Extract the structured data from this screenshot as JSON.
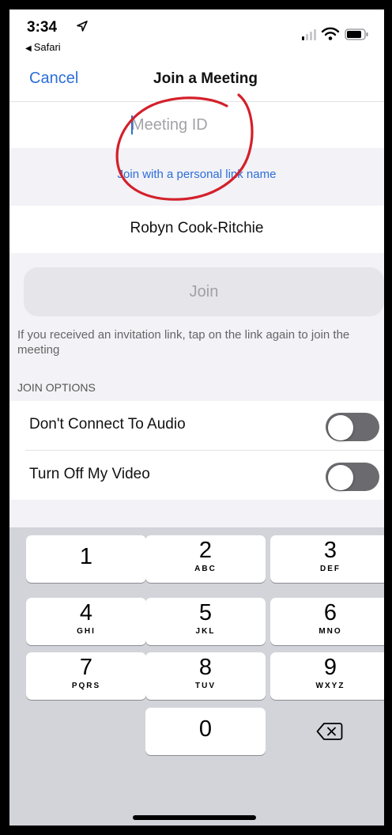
{
  "status_bar": {
    "time": "3:34",
    "back_app": "Safari"
  },
  "nav": {
    "cancel_label": "Cancel",
    "title": "Join a Meeting"
  },
  "meeting_id": {
    "placeholder": "Meeting ID",
    "value": ""
  },
  "personal_link_label": "Join with a personal link name",
  "display_name": "Robyn Cook-Ritchie",
  "join_label": "Join",
  "invite_hint": "If you received an invitation link, tap on the link again to join the meeting",
  "join_options": {
    "title": "JOIN OPTIONS",
    "options": [
      {
        "label": "Don't Connect To Audio",
        "enabled": false
      },
      {
        "label": "Turn Off My Video",
        "enabled": false
      }
    ]
  },
  "keypad": {
    "keys": [
      {
        "number": "1",
        "letters": ""
      },
      {
        "number": "2",
        "letters": "ABC"
      },
      {
        "number": "3",
        "letters": "DEF"
      },
      {
        "number": "4",
        "letters": "GHI"
      },
      {
        "number": "5",
        "letters": "JKL"
      },
      {
        "number": "6",
        "letters": "MNO"
      },
      {
        "number": "7",
        "letters": "PQRS"
      },
      {
        "number": "8",
        "letters": "TUV"
      },
      {
        "number": "9",
        "letters": "WXYZ"
      },
      {
        "number": "0",
        "letters": ""
      }
    ],
    "delete_icon": "backspace-icon"
  },
  "colors": {
    "accent": "#2c6ed8",
    "annotation": "#d4202a",
    "toggle_off": "#6b6b6f"
  }
}
